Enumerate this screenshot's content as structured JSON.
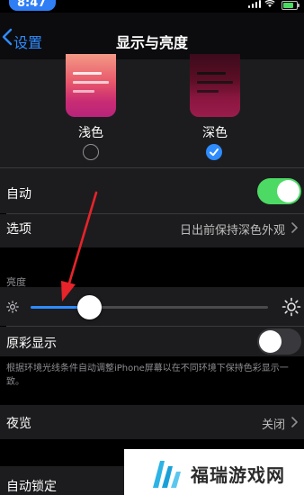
{
  "status_bar": {
    "time": "8:47",
    "icons": [
      "cellular-signal-icon",
      "wifi-icon",
      "battery-icon"
    ]
  },
  "nav": {
    "back_label": "设置",
    "title": "显示与亮度"
  },
  "appearance": {
    "options": [
      {
        "label": "浅色",
        "selected": false
      },
      {
        "label": "深色",
        "selected": true
      }
    ]
  },
  "automatic": {
    "label": "自动",
    "on": true
  },
  "options_row": {
    "label": "选项",
    "value": "日出前保持深色外观"
  },
  "brightness": {
    "header": "亮度",
    "level": 0.24,
    "icons": [
      "sun-small-icon",
      "sun-large-icon"
    ]
  },
  "true_tone": {
    "label": "原彩显示",
    "on": false,
    "footnote": "根据环境光线条件自动调整iPhone屏幕以在不同环境下保持色彩显示一致。"
  },
  "night_shift": {
    "label": "夜览",
    "value": "关闭"
  },
  "auto_lock": {
    "label": "自动锁定"
  },
  "watermark": {
    "text": "福瑞游戏网"
  },
  "colors": {
    "accent": "#2f8cff",
    "toggle_on": "#4cd964",
    "annotation_arrow": "#e8232a"
  }
}
